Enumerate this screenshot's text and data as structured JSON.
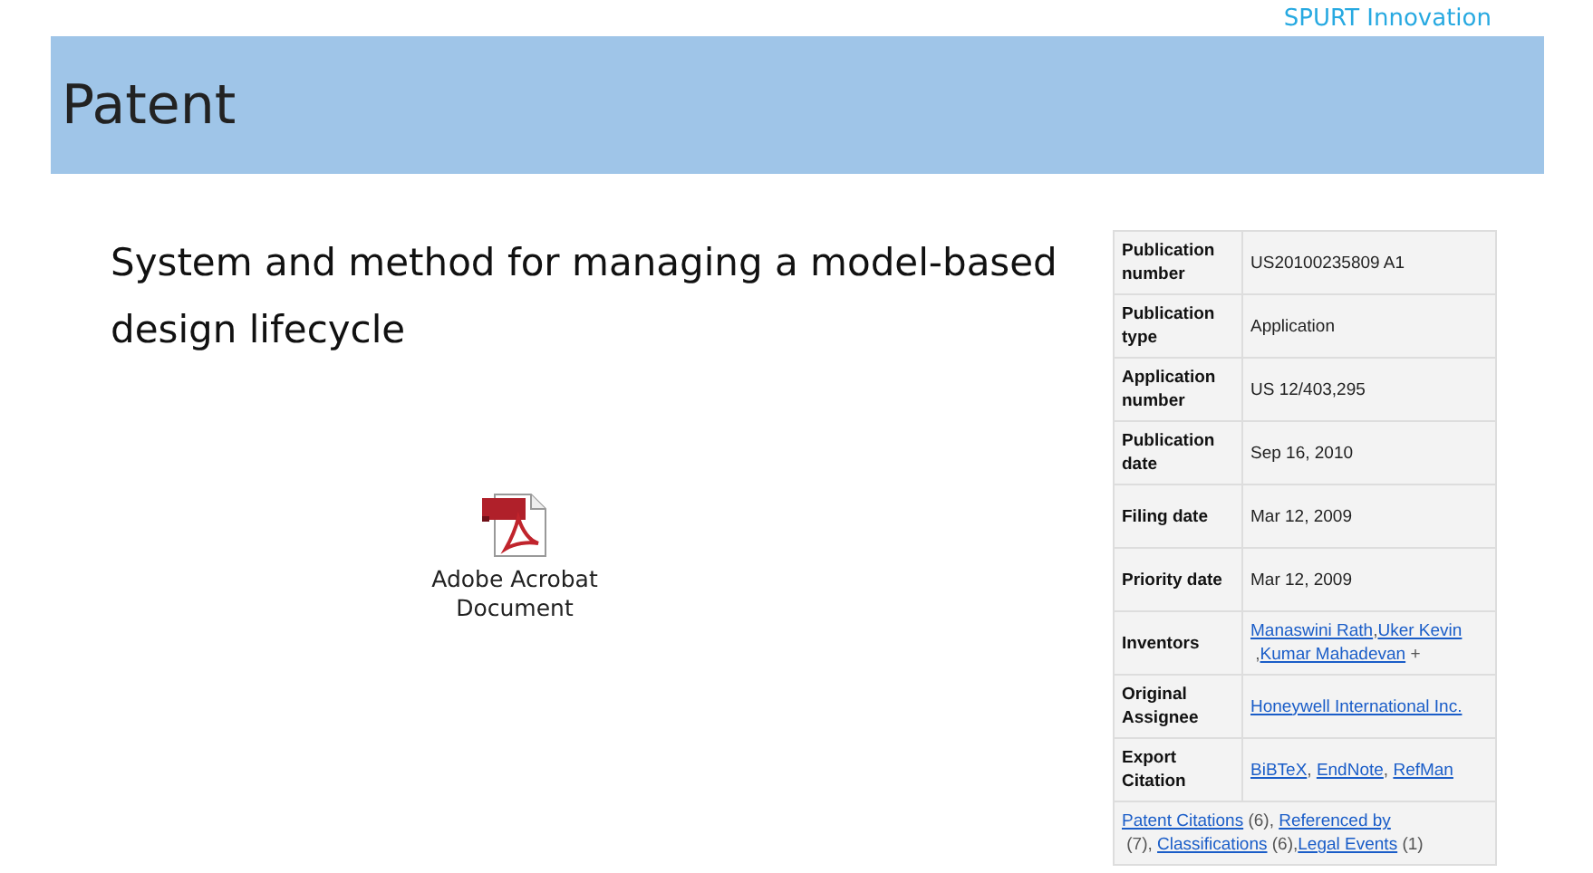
{
  "brand": "SPURT Innovation",
  "header": {
    "title": "Patent"
  },
  "patent_title": "System and method for managing a model-based design lifecycle",
  "attachment": {
    "label": "Adobe Acrobat Document"
  },
  "details": [
    {
      "label": "Publication number",
      "kind": "text",
      "value": "US20100235809 A1"
    },
    {
      "label": "Publication type",
      "kind": "text",
      "value": "Application"
    },
    {
      "label": "Application number",
      "kind": "text",
      "value": "US 12/403,295"
    },
    {
      "label": "Publication date",
      "kind": "text",
      "value": "Sep 16, 2010"
    },
    {
      "label": "Filing date",
      "kind": "text",
      "value": "Mar 12, 2009"
    },
    {
      "label": "Priority date",
      "kind": "text",
      "value": "Mar 12, 2009"
    },
    {
      "label": "Inventors",
      "kind": "links",
      "links": [
        {
          "text": "Manaswini Rath",
          "after": ","
        },
        {
          "text": "Uker Kevin",
          "after": " ,"
        },
        {
          "text": "Kumar Mahadevan",
          "after": " +"
        }
      ]
    },
    {
      "label": "Original Assignee",
      "kind": "links",
      "links": [
        {
          "text": "Honeywell International Inc."
        }
      ]
    },
    {
      "label": "Export Citation",
      "kind": "links",
      "links": [
        {
          "text": "BiBTeX",
          "after": ", "
        },
        {
          "text": "EndNote",
          "after": ", "
        },
        {
          "text": "RefMan"
        }
      ]
    }
  ],
  "footer_links": [
    {
      "text": "Patent Citations",
      "after": " (6), "
    },
    {
      "text": "Referenced by",
      "after": " (7), "
    },
    {
      "text": "Classifications",
      "after": " (6),"
    },
    {
      "text": "Legal Events",
      "after": " (1)"
    }
  ]
}
